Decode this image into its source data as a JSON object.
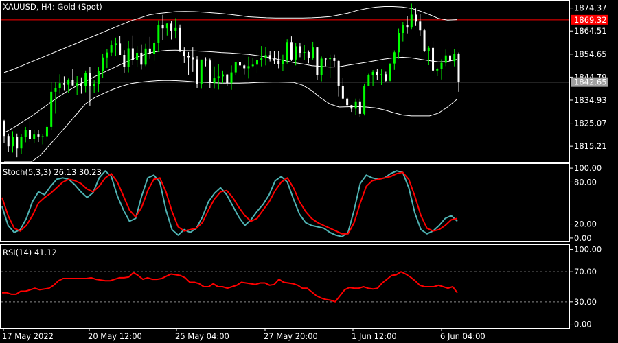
{
  "chart_title": "XAUUSD, H4:  Gold (Spot)",
  "colors": {
    "background": "#000000",
    "frame": "#ffffff",
    "bull_candle": "#00ff00",
    "bear_candle": "#ffffff",
    "bands": "#ffffff",
    "stoch_main": "#4fb3b3",
    "stoch_signal": "#ff0000",
    "rsi": "#ff0000",
    "resistance_line": "#ff0000",
    "price_line": "#8a8a8a",
    "resistance_tag": "#ff0000",
    "price_tag": "#a0a0a0"
  },
  "chart_data": [
    {
      "type": "candlestick",
      "title": "XAUUSD, H4:  Gold (Spot)",
      "y_ticks": [
        "1874.37",
        "1864.51",
        "1854.65",
        "1844.79",
        "1834.93",
        "1825.07",
        "1815.21"
      ],
      "ylim": [
        1808.5,
        1877.5
      ],
      "x_ticks": [
        "17 May 2022",
        "20 May 12:00",
        "25 May 04:00",
        "27 May 20:00",
        "1 Jun 12:00",
        "6 Jun 04:00"
      ],
      "price_levels": {
        "resistance": 1869.32,
        "resistance_label": "1869.32",
        "current": 1842.65,
        "current_label": "1842.65"
      },
      "candles": [
        [
          1825.8,
          1826.5,
          1816.5,
          1819.6
        ],
        [
          1819.6,
          1820.6,
          1812.7,
          1815.2
        ],
        [
          1815.2,
          1821.6,
          1812.5,
          1819.1
        ],
        [
          1819.1,
          1820.6,
          1810.5,
          1814.3
        ],
        [
          1814.3,
          1820.3,
          1811.9,
          1819.2
        ],
        [
          1819.2,
          1823.5,
          1816.9,
          1822.2
        ],
        [
          1822.2,
          1827.3,
          1817.0,
          1818.3
        ],
        [
          1818.3,
          1822.3,
          1816.6,
          1820.2
        ],
        [
          1820.2,
          1822.0,
          1817.0,
          1819.4
        ],
        [
          1819.4,
          1820.3,
          1816.0,
          1819.5
        ],
        [
          1819.5,
          1824.4,
          1817.6,
          1823.5
        ],
        [
          1823.5,
          1842.6,
          1822.1,
          1838.5
        ],
        [
          1838.5,
          1842.6,
          1829.2,
          1840.0
        ],
        [
          1840.0,
          1846.0,
          1837.7,
          1842.2
        ],
        [
          1842.2,
          1845.1,
          1839.2,
          1841.5
        ],
        [
          1841.5,
          1844.2,
          1837.9,
          1843.5
        ],
        [
          1843.5,
          1848.4,
          1840.9,
          1841.2
        ],
        [
          1841.2,
          1845.2,
          1837.2,
          1842.2
        ],
        [
          1842.2,
          1844.7,
          1837.7,
          1840.9
        ],
        [
          1840.9,
          1847.6,
          1838.3,
          1846.4
        ],
        [
          1846.4,
          1849.1,
          1832.6,
          1840.9
        ],
        [
          1840.9,
          1843.4,
          1838.1,
          1841.8
        ],
        [
          1841.8,
          1849.0,
          1838.4,
          1847.5
        ],
        [
          1847.5,
          1854.9,
          1844.6,
          1853.2
        ],
        [
          1853.2,
          1856.9,
          1848.7,
          1855.3
        ],
        [
          1855.3,
          1860.3,
          1853.7,
          1858.4
        ],
        [
          1858.4,
          1861.7,
          1853.9,
          1859.2
        ],
        [
          1859.2,
          1862.4,
          1855.8,
          1854.3
        ],
        [
          1854.3,
          1856.3,
          1846.7,
          1849.1
        ],
        [
          1849.1,
          1860.2,
          1846.8,
          1857.1
        ],
        [
          1857.1,
          1862.6,
          1849.9,
          1852.0
        ],
        [
          1852.0,
          1858.1,
          1849.2,
          1855.2
        ],
        [
          1855.2,
          1858.8,
          1848.0,
          1850.1
        ],
        [
          1850.1,
          1859.1,
          1849.5,
          1857.0
        ],
        [
          1857.0,
          1862.0,
          1852.6,
          1854.7
        ],
        [
          1854.7,
          1860.8,
          1851.8,
          1859.6
        ],
        [
          1859.6,
          1869.1,
          1855.5,
          1867.2
        ],
        [
          1867.2,
          1871.4,
          1860.6,
          1865.7
        ],
        [
          1865.7,
          1868.1,
          1862.6,
          1867.7
        ],
        [
          1867.7,
          1868.8,
          1860.9,
          1864.6
        ],
        [
          1864.6,
          1870.0,
          1861.3,
          1865.8
        ],
        [
          1865.8,
          1867.3,
          1855.5,
          1855.7
        ],
        [
          1855.7,
          1857.5,
          1850.8,
          1853.9
        ],
        [
          1853.9,
          1855.5,
          1845.8,
          1853.3
        ],
        [
          1853.3,
          1857.5,
          1847.0,
          1852.4
        ],
        [
          1852.4,
          1853.7,
          1840.1,
          1841.7
        ],
        [
          1841.7,
          1851.3,
          1839.8,
          1852.3
        ],
        [
          1852.3,
          1853.3,
          1849.4,
          1851.9
        ],
        [
          1851.9,
          1852.7,
          1840.2,
          1842.3
        ],
        [
          1842.3,
          1849.4,
          1839.8,
          1844.3
        ],
        [
          1844.3,
          1850.4,
          1839.5,
          1845.1
        ],
        [
          1845.1,
          1847.6,
          1842.2,
          1845.9
        ],
        [
          1845.9,
          1846.1,
          1840.8,
          1842.2
        ],
        [
          1842.2,
          1849.8,
          1839.4,
          1846.8
        ],
        [
          1846.8,
          1851.4,
          1845.8,
          1851.3
        ],
        [
          1851.3,
          1854.9,
          1847.2,
          1849.8
        ],
        [
          1849.8,
          1850.3,
          1845.9,
          1848.6
        ],
        [
          1848.6,
          1853.5,
          1844.2,
          1849.5
        ],
        [
          1849.5,
          1853.1,
          1848.9,
          1850.1
        ],
        [
          1850.1,
          1856.3,
          1846.5,
          1852.2
        ],
        [
          1852.2,
          1858.1,
          1849.4,
          1853.1
        ],
        [
          1853.1,
          1857.7,
          1849.8,
          1854.2
        ],
        [
          1854.2,
          1855.8,
          1851.5,
          1852.5
        ],
        [
          1852.5,
          1856.0,
          1850.4,
          1851.8
        ],
        [
          1851.8,
          1855.8,
          1848.6,
          1850.3
        ],
        [
          1850.3,
          1854.4,
          1847.4,
          1852.1
        ],
        [
          1852.1,
          1861.0,
          1850.6,
          1859.8
        ],
        [
          1859.8,
          1862.2,
          1851.7,
          1852.3
        ],
        [
          1852.3,
          1859.6,
          1849.8,
          1858.0
        ],
        [
          1858.0,
          1859.6,
          1853.3,
          1855.2
        ],
        [
          1855.2,
          1858.5,
          1852.2,
          1855.5
        ],
        [
          1855.5,
          1856.2,
          1850.7,
          1853.1
        ],
        [
          1853.1,
          1859.9,
          1852.3,
          1857.5
        ],
        [
          1857.5,
          1857.8,
          1843.6,
          1845.5
        ],
        [
          1845.5,
          1853.6,
          1843.0,
          1852.7
        ],
        [
          1852.7,
          1852.9,
          1849.5,
          1852.5
        ],
        [
          1852.5,
          1854.4,
          1844.5,
          1853.1
        ],
        [
          1853.1,
          1854.4,
          1849.2,
          1851.7
        ],
        [
          1851.7,
          1851.9,
          1836.5,
          1841.1
        ],
        [
          1841.1,
          1844.4,
          1835.1,
          1835.6
        ],
        [
          1835.6,
          1836.0,
          1831.9,
          1832.8
        ],
        [
          1832.8,
          1832.9,
          1829.9,
          1831.3
        ],
        [
          1831.3,
          1835.6,
          1828.6,
          1834.4
        ],
        [
          1834.4,
          1835.6,
          1827.6,
          1829.1
        ],
        [
          1829.1,
          1842.0,
          1828.4,
          1841.1
        ],
        [
          1841.1,
          1846.2,
          1840.9,
          1845.5
        ],
        [
          1845.5,
          1847.8,
          1840.8,
          1847.0
        ],
        [
          1847.0,
          1848.2,
          1843.7,
          1845.7
        ],
        [
          1845.7,
          1848.1,
          1841.4,
          1846.0
        ],
        [
          1846.0,
          1847.1,
          1842.9,
          1843.2
        ],
        [
          1843.2,
          1849.1,
          1843.0,
          1850.6
        ],
        [
          1850.6,
          1856.2,
          1847.9,
          1855.4
        ],
        [
          1855.4,
          1865.6,
          1852.7,
          1863.7
        ],
        [
          1863.7,
          1868.4,
          1860.0,
          1867.0
        ],
        [
          1867.0,
          1870.9,
          1863.5,
          1866.0
        ],
        [
          1866.0,
          1876.2,
          1865.1,
          1871.5
        ],
        [
          1871.5,
          1874.2,
          1866.7,
          1868.6
        ],
        [
          1868.6,
          1871.8,
          1862.3,
          1864.8
        ],
        [
          1864.8,
          1865.5,
          1855.5,
          1856.0
        ],
        [
          1856.0,
          1858.1,
          1849.9,
          1857.3
        ],
        [
          1857.3,
          1860.1,
          1846.4,
          1847.6
        ],
        [
          1847.6,
          1848.8,
          1845.2,
          1848.2
        ],
        [
          1848.2,
          1852.4,
          1843.8,
          1850.9
        ],
        [
          1850.9,
          1856.6,
          1849.5,
          1854.1
        ],
        [
          1854.1,
          1857.4,
          1848.6,
          1851.6
        ],
        [
          1851.6,
          1856.8,
          1849.4,
          1854.7
        ],
        [
          1854.7,
          1855.3,
          1838.5,
          1842.7
        ]
      ],
      "bollinger": {
        "upper": [
          1846.7,
          1848.1,
          1849.7,
          1851.3,
          1852.9,
          1854.5,
          1856.1,
          1857.7,
          1859.3,
          1860.9,
          1862.5,
          1864.1,
          1865.7,
          1867.3,
          1868.9,
          1870.1,
          1871.4,
          1872.0,
          1872.4,
          1872.8,
          1872.9,
          1872.8,
          1872.6,
          1872.3,
          1872.0,
          1871.6,
          1871.1,
          1870.6,
          1870.4,
          1870.2,
          1870.1,
          1870.1,
          1870.1,
          1870.1,
          1870.2,
          1870.4,
          1870.7,
          1871.4,
          1872.2,
          1873.3,
          1874.1,
          1874.7,
          1875.0,
          1875.0,
          1874.8,
          1874.2,
          1873.0,
          1871.5,
          1869.9,
          1869.2,
          1869.4
        ],
        "middle": [
          1820.9,
          1823.1,
          1825.5,
          1828.0,
          1830.8,
          1833.6,
          1836.3,
          1838.8,
          1841.0,
          1843.0,
          1845.0,
          1846.8,
          1848.6,
          1850.4,
          1852.2,
          1853.8,
          1855.1,
          1855.8,
          1856.2,
          1856.3,
          1856.1,
          1856.0,
          1855.8,
          1855.6,
          1855.3,
          1855.1,
          1854.8,
          1854.5,
          1854.0,
          1853.4,
          1852.6,
          1851.8,
          1851.0,
          1850.4,
          1849.7,
          1849.4,
          1849.1,
          1849.2,
          1849.9,
          1850.5,
          1851.1,
          1851.8,
          1852.5,
          1853.0,
          1853.3,
          1853.0,
          1852.4,
          1851.8,
          1851.3,
          1851.5,
          1852.3
        ],
        "lower": [
          1808.5,
          1808.5,
          1808.5,
          1808.5,
          1811.3,
          1815.6,
          1820.0,
          1824.4,
          1828.9,
          1833.4,
          1836.0,
          1837.8,
          1839.5,
          1840.9,
          1842.0,
          1842.6,
          1843.0,
          1843.3,
          1843.4,
          1843.3,
          1843.1,
          1842.8,
          1842.6,
          1842.4,
          1842.2,
          1842.2,
          1842.2,
          1842.3,
          1842.5,
          1842.6,
          1842.7,
          1842.6,
          1842.5,
          1841.3,
          1839.0,
          1835.8,
          1833.3,
          1832.0,
          1832.1,
          1832.2,
          1832.0,
          1831.6,
          1830.8,
          1829.6,
          1828.6,
          1828.2,
          1828.2,
          1828.2,
          1829.4,
          1832.0,
          1835.2
        ]
      }
    },
    {
      "type": "line",
      "title": "Stoch(5,3,3) 26.13 30.23",
      "y_ticks": [
        "100.00",
        "80.00",
        "20.00",
        "0.00"
      ],
      "ylim": [
        -5,
        105
      ],
      "levels": [
        80,
        20
      ],
      "series": [
        {
          "name": "Stoch(5,3,3)",
          "values": [
            45,
            18,
            8,
            12,
            28,
            52,
            66,
            62,
            74,
            84,
            86,
            84,
            76,
            66,
            58,
            65,
            86,
            96,
            88,
            60,
            40,
            24,
            28,
            60,
            86,
            90,
            80,
            40,
            12,
            4,
            12,
            8,
            14,
            30,
            52,
            64,
            72,
            62,
            46,
            30,
            18,
            26,
            38,
            48,
            62,
            82,
            88,
            80,
            56,
            34,
            22,
            18,
            16,
            14,
            8,
            4,
            2,
            8,
            40,
            78,
            90,
            86,
            84,
            86,
            92,
            96,
            94,
            72,
            36,
            12,
            6,
            10,
            18,
            28,
            32,
            24
          ]
        },
        {
          "name": "",
          "values": [
            58,
            32,
            14,
            10,
            18,
            32,
            50,
            58,
            64,
            72,
            80,
            84,
            82,
            78,
            70,
            66,
            74,
            86,
            92,
            80,
            60,
            40,
            30,
            44,
            68,
            84,
            86,
            66,
            38,
            16,
            10,
            12,
            14,
            22,
            40,
            56,
            66,
            68,
            58,
            44,
            32,
            24,
            28,
            40,
            52,
            68,
            80,
            86,
            72,
            52,
            38,
            28,
            22,
            18,
            14,
            10,
            6,
            6,
            22,
            50,
            74,
            82,
            84,
            86,
            88,
            92,
            94,
            84,
            60,
            32,
            14,
            10,
            12,
            18,
            26,
            28
          ]
        }
      ]
    },
    {
      "type": "line",
      "title": "RSI(14) 41.12",
      "y_ticks": [
        "100.00",
        "70.00",
        "30.00",
        "0.00"
      ],
      "ylim": [
        -5,
        105
      ],
      "levels": [
        70,
        30
      ],
      "series": [
        {
          "name": "RSI(14)",
          "values": [
            42,
            42,
            40,
            40,
            44,
            44,
            46,
            48,
            46,
            47,
            48,
            52,
            58,
            61,
            61,
            61,
            61,
            61,
            61,
            62,
            60,
            59,
            58,
            58,
            60,
            62,
            62,
            63,
            69,
            65,
            60,
            62,
            60,
            60,
            61,
            64,
            67,
            66,
            65,
            62,
            56,
            56,
            54,
            50,
            50,
            54,
            50,
            50,
            48,
            50,
            52,
            56,
            55,
            54,
            53,
            55,
            55,
            52,
            53,
            60,
            56,
            55,
            54,
            52,
            48,
            48,
            43,
            38,
            35,
            33,
            32,
            30,
            38,
            46,
            49,
            48,
            48,
            50,
            48,
            47,
            48,
            55,
            60,
            65,
            66,
            70,
            67,
            63,
            58,
            52,
            50,
            50,
            50,
            52,
            50,
            48,
            50,
            42
          ]
        }
      ]
    }
  ]
}
